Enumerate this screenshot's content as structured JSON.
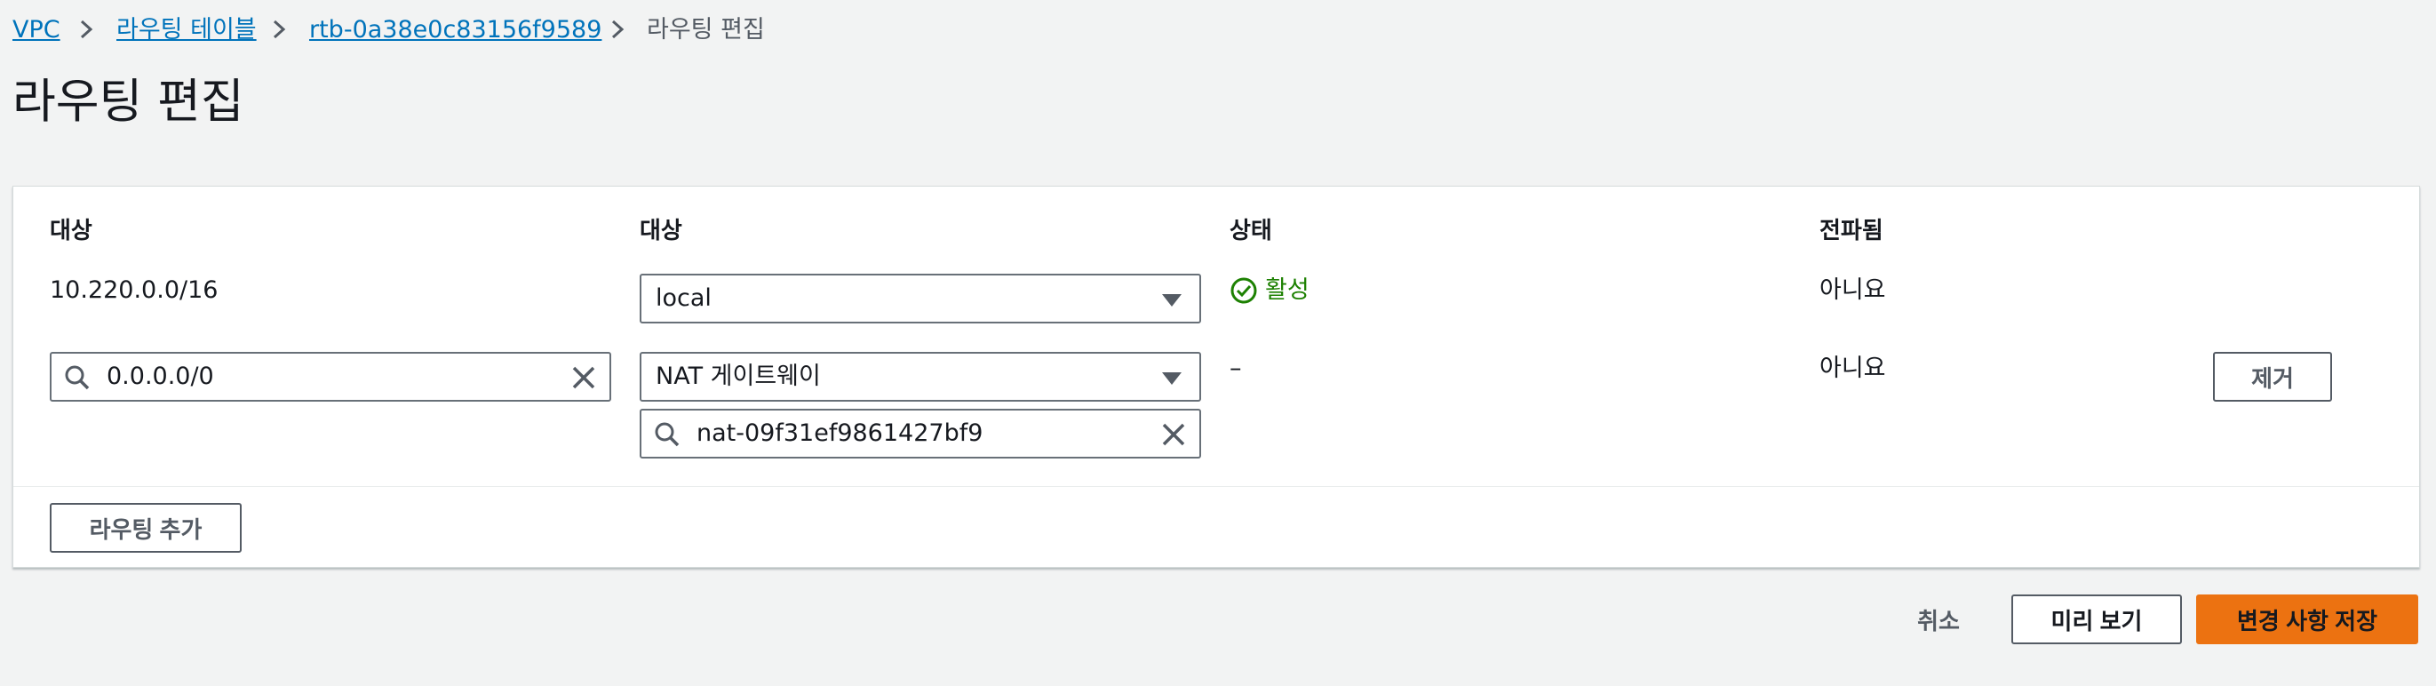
{
  "breadcrumb": {
    "items": [
      "VPC",
      "라우팅 테이블",
      "rtb-0a38e0c83156f9589"
    ],
    "current": "라우팅 편집"
  },
  "page": {
    "title": "라우팅 편집"
  },
  "table": {
    "headers": [
      "대상",
      "대상",
      "상태",
      "전파됨"
    ],
    "rows": [
      {
        "destination": "10.220.0.0/16",
        "target_type": "local",
        "status": "활성",
        "propagated": "아니요"
      },
      {
        "destination": "0.0.0.0/0",
        "target_type": "NAT 게이트웨이",
        "target_id": "nat-09f31ef9861427bf9",
        "status": "–",
        "propagated": "아니요",
        "remove_label": "제거"
      }
    ],
    "add_route_label": "라우팅 추가"
  },
  "actions": {
    "cancel": "취소",
    "preview": "미리 보기",
    "save": "변경 사항 저장"
  },
  "colors": {
    "link": "#0073bb",
    "primary": "#ec7211",
    "success": "#1d8102"
  },
  "icons": [
    "chevron-right-icon",
    "search-icon",
    "clear-icon",
    "dropdown-caret-icon",
    "status-success-icon"
  ]
}
